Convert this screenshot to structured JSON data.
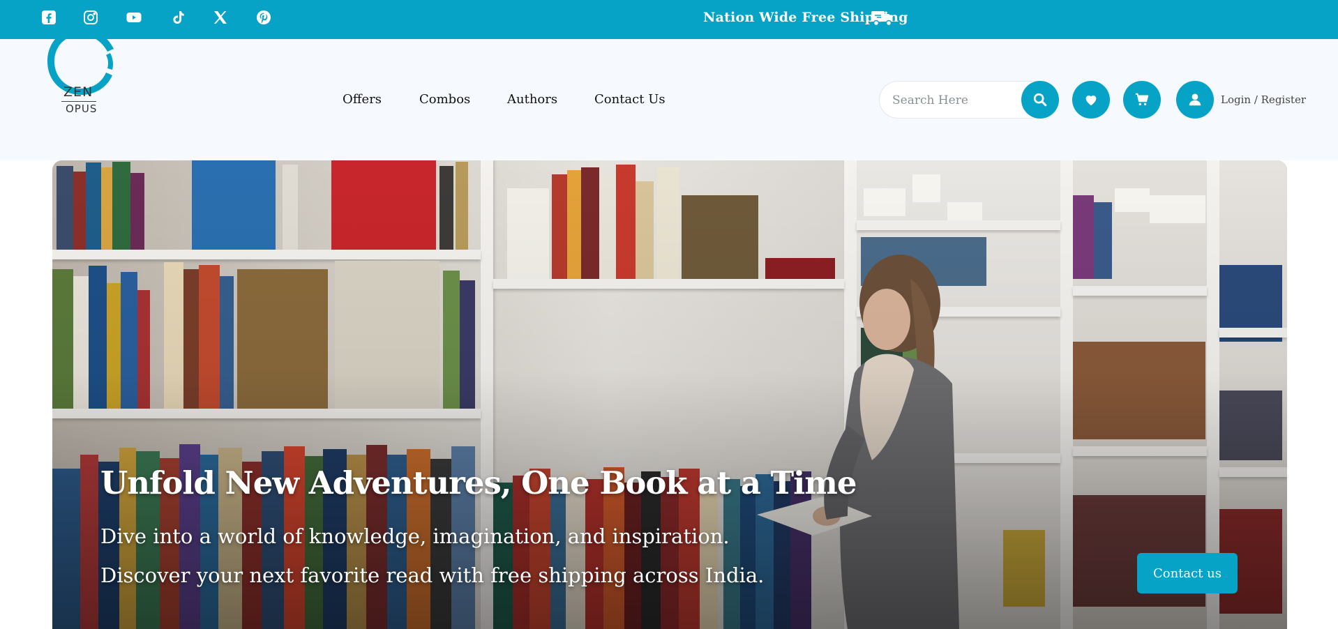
{
  "topbar": {
    "social": [
      {
        "name": "facebook-icon"
      },
      {
        "name": "instagram-icon"
      },
      {
        "name": "youtube-icon"
      },
      {
        "name": "tiktok-icon"
      },
      {
        "name": "x-icon"
      },
      {
        "name": "pinterest-icon"
      }
    ],
    "shipping_text": "Nation Wide Free Shipping",
    "shipping_icon": "truck-icon",
    "background": "#06a3c6"
  },
  "header": {
    "logo_line1": "ZEN",
    "logo_line2": "OPUS",
    "nav": [
      {
        "label": "Offers"
      },
      {
        "label": "Combos"
      },
      {
        "label": "Authors"
      },
      {
        "label": "Contact Us"
      }
    ],
    "search": {
      "placeholder": "Search Here"
    },
    "icons": [
      "search-icon",
      "heart-icon",
      "cart-icon",
      "user-icon"
    ],
    "login_label": "Login / Register",
    "accent": "#06a3c6"
  },
  "hero": {
    "title": "Unfold New Adventures, One Book at a Time",
    "subtitle": "Dive into a world of knowledge, imagination, and inspiration. Discover your next favorite read with free shipping across India.",
    "cta_label": "Contact us"
  }
}
